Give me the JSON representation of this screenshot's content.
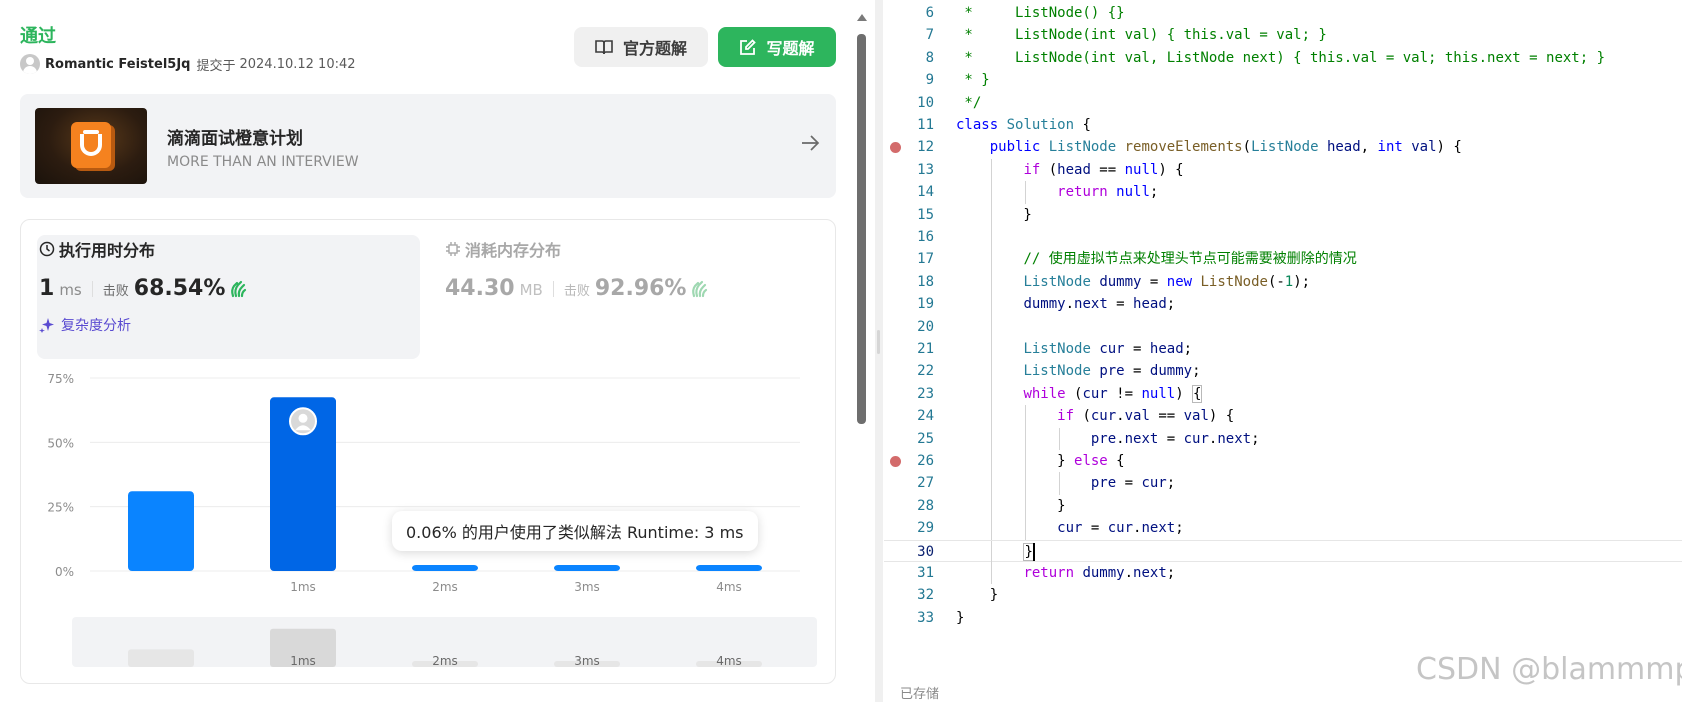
{
  "result": {
    "status": "通过",
    "user_name": "Romantic Feistel5Jq",
    "submitted_label": "提交于",
    "submitted_time": "2024.10.12 10:42"
  },
  "buttons": {
    "official_solution": "官方题解",
    "write_solution": "写题解"
  },
  "promo": {
    "title": "滴滴面试橙意计划",
    "subtitle": "MORE THAN AN INTERVIEW"
  },
  "runtime": {
    "title": "执行用时分布",
    "value": "1",
    "unit": "ms",
    "beats_label": "击败",
    "beats_pct": "68.54%",
    "complexity_link": "复杂度分析"
  },
  "memory": {
    "title": "消耗内存分布",
    "value": "44.30",
    "unit": "MB",
    "beats_label": "击败",
    "beats_pct": "92.96%"
  },
  "tooltip": "0.06% 的用户使用了类似解法 Runtime: 3 ms",
  "chart_data": {
    "type": "bar",
    "categories": [
      "",
      "1ms",
      "2ms",
      "3ms",
      "4ms"
    ],
    "values": [
      31,
      67.5,
      0.5,
      0.5,
      0.5
    ],
    "ylim": [
      0,
      75
    ],
    "yticks": [
      "0%",
      "25%",
      "50%",
      "75%"
    ],
    "ytick_values": [
      0,
      25,
      50,
      75
    ],
    "highlight_index": 1,
    "grid": true,
    "colors": {
      "bar": "#0a84ff",
      "highlight": "#0066e6",
      "grid": "#ececec"
    },
    "mini_categories": [
      "",
      "1ms",
      "2ms",
      "3ms",
      "4ms"
    ],
    "mini_values": [
      31,
      67.5,
      0.5,
      0.5,
      0.5
    ],
    "mini_ylim": [
      0,
      75
    ]
  },
  "code": {
    "first_line": 6,
    "current_line": 30,
    "breakpoints": [
      12,
      26
    ]
  },
  "editor": {
    "saved_label": "已存储",
    "watermark": "CSDN @blammmp"
  },
  "colors": {
    "accent_green": "#2db55d",
    "accent_blue": "#0a84ff",
    "purple": "#5a4bd1"
  }
}
